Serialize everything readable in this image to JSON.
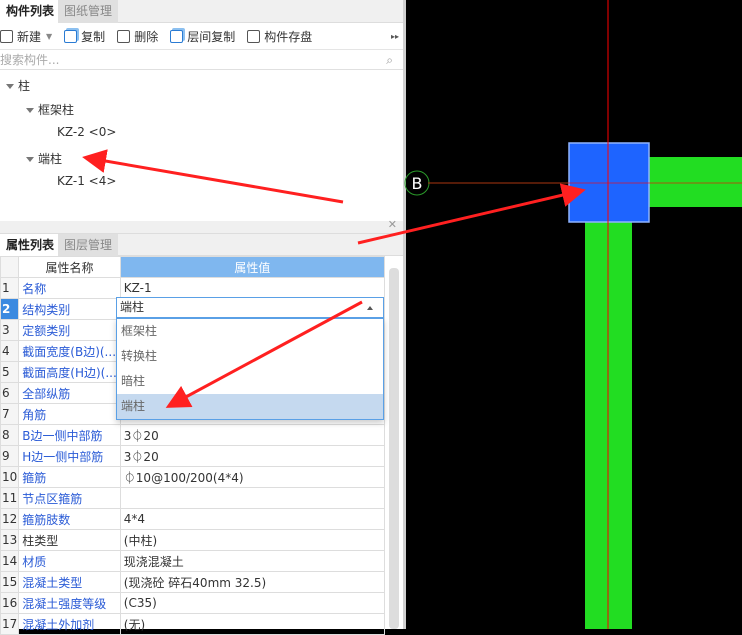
{
  "top_tabs": [
    {
      "label": "构件列表"
    },
    {
      "label": "图纸管理"
    }
  ],
  "toolbar": {
    "new": "新建",
    "copy": "复制",
    "delete": "删除",
    "floor_copy": "层间复制",
    "save": "构件存盘"
  },
  "search": {
    "placeholder": "搜索构件..."
  },
  "tree": {
    "root": "柱",
    "group1": "框架柱",
    "item1": "KZ-2 <0>",
    "group2": "端柱",
    "item2": "KZ-1 <4>"
  },
  "bottom_tabs": [
    {
      "label": "属性列表"
    },
    {
      "label": "图层管理"
    }
  ],
  "table": {
    "headers": {
      "name": "属性名称",
      "value": "属性值"
    },
    "rows": [
      {
        "n": "1",
        "name": "名称",
        "value": "KZ-1"
      },
      {
        "n": "2",
        "name": "结构类别",
        "value": "端柱"
      },
      {
        "n": "3",
        "name": "定额类别",
        "value": ""
      },
      {
        "n": "4",
        "name": "截面宽度(B边)(...",
        "value": ""
      },
      {
        "n": "5",
        "name": "截面高度(H边)(...",
        "value": ""
      },
      {
        "n": "6",
        "name": "全部纵筋",
        "value": ""
      },
      {
        "n": "7",
        "name": "角筋",
        "value": ""
      },
      {
        "n": "8",
        "name": "B边一侧中部筋",
        "value": "3⏀20"
      },
      {
        "n": "9",
        "name": "H边一侧中部筋",
        "value": "3⏀20"
      },
      {
        "n": "10",
        "name": "箍筋",
        "value": "⏀10@100/200(4*4)"
      },
      {
        "n": "11",
        "name": "节点区箍筋",
        "value": ""
      },
      {
        "n": "12",
        "name": "箍筋肢数",
        "value": "4*4"
      },
      {
        "n": "13",
        "name": "柱类型",
        "value": "(中柱)"
      },
      {
        "n": "14",
        "name": "材质",
        "value": "现浇混凝土"
      },
      {
        "n": "15",
        "name": "混凝土类型",
        "value": "(现浇砼 碎石40mm 32.5)"
      },
      {
        "n": "16",
        "name": "混凝土强度等级",
        "value": "(C35)"
      },
      {
        "n": "17",
        "name": "混凝土外加剂",
        "value": "(无)"
      }
    ]
  },
  "dropdown": {
    "selected": "端柱",
    "options": [
      "框架柱",
      "转换柱",
      "暗柱",
      "端柱"
    ]
  },
  "canvas": {
    "axis_label": "B",
    "colors": {
      "column": "#1e64ff",
      "beam": "#22dd22",
      "axis": "#ff0000",
      "annotation": "#ff2020"
    }
  }
}
